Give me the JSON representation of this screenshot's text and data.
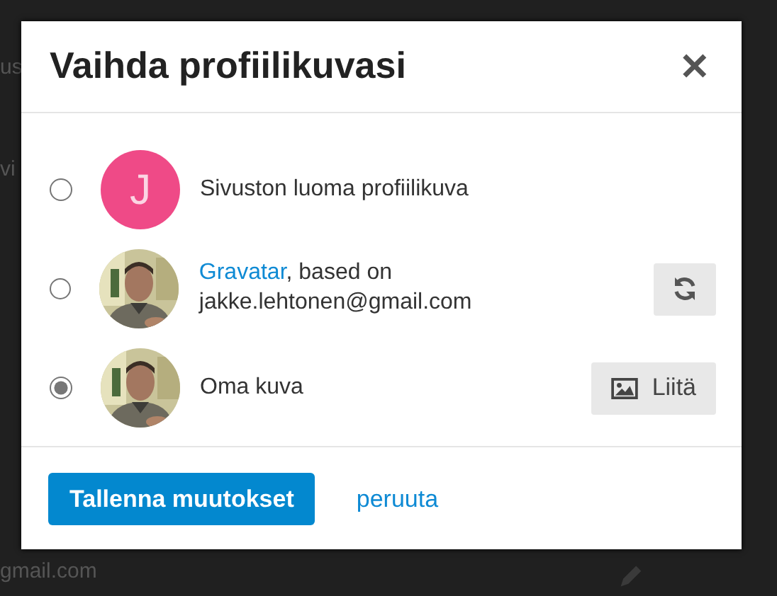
{
  "background": {
    "texts": [
      "us",
      "vi",
      "gmail.com"
    ]
  },
  "dialog": {
    "title": "Vaihda profiilikuvasi",
    "close": "✕",
    "options": [
      {
        "selected": false,
        "avatar": {
          "kind": "letter",
          "letter": "J"
        },
        "text": "Sivuston luoma profiilikuva"
      },
      {
        "selected": false,
        "link": "Gravatar",
        "text": ", based on jakke.lehtonen@gmail.com",
        "action": {
          "kind": "refresh"
        }
      },
      {
        "selected": true,
        "text": "Oma kuva",
        "action": {
          "kind": "upload",
          "label": "Liitä"
        }
      }
    ],
    "buttons": [
      {
        "kind": "primary",
        "label": "Tallenna muutokset"
      },
      {
        "kind": "link",
        "label": "peruuta"
      }
    ]
  }
}
